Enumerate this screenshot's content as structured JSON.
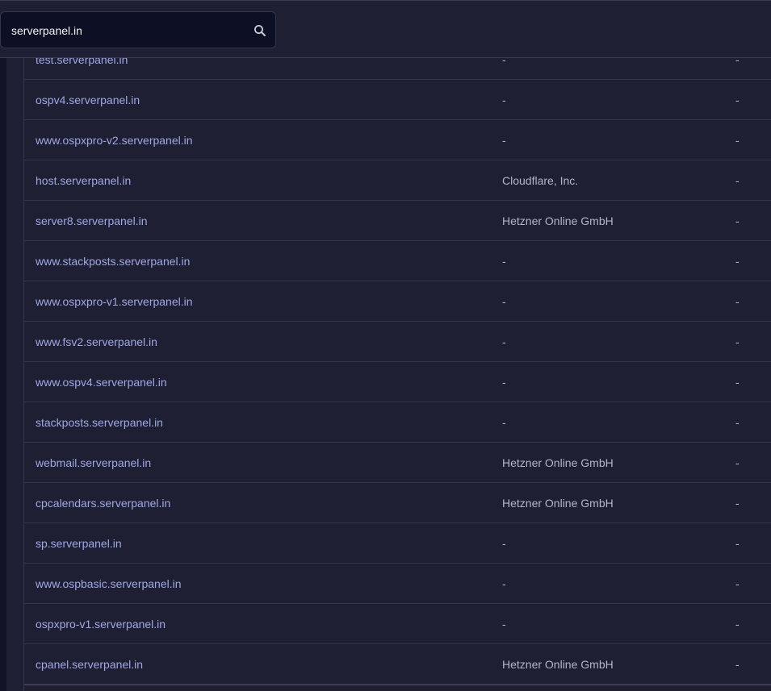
{
  "search": {
    "value": "serverpanel.in",
    "icon": "search-icon"
  },
  "table": {
    "rows": [
      {
        "host": "test.serverpanel.in",
        "org": "-",
        "extra": "-"
      },
      {
        "host": "ospv4.serverpanel.in",
        "org": "-",
        "extra": "-"
      },
      {
        "host": "www.ospxpro-v2.serverpanel.in",
        "org": "-",
        "extra": "-"
      },
      {
        "host": "host.serverpanel.in",
        "org": "Cloudflare, Inc.",
        "extra": "-"
      },
      {
        "host": "server8.serverpanel.in",
        "org": "Hetzner Online GmbH",
        "extra": "-"
      },
      {
        "host": "www.stackposts.serverpanel.in",
        "org": "-",
        "extra": "-"
      },
      {
        "host": "www.ospxpro-v1.serverpanel.in",
        "org": "-",
        "extra": "-"
      },
      {
        "host": "www.fsv2.serverpanel.in",
        "org": "-",
        "extra": "-"
      },
      {
        "host": "www.ospv4.serverpanel.in",
        "org": "-",
        "extra": "-"
      },
      {
        "host": "stackposts.serverpanel.in",
        "org": "-",
        "extra": "-"
      },
      {
        "host": "webmail.serverpanel.in",
        "org": "Hetzner Online GmbH",
        "extra": "-"
      },
      {
        "host": "cpcalendars.serverpanel.in",
        "org": "Hetzner Online GmbH",
        "extra": "-"
      },
      {
        "host": "sp.serverpanel.in",
        "org": "-",
        "extra": "-"
      },
      {
        "host": "www.ospbasic.serverpanel.in",
        "org": "-",
        "extra": "-"
      },
      {
        "host": "ospxpro-v1.serverpanel.in",
        "org": "-",
        "extra": "-"
      },
      {
        "host": "cpanel.serverpanel.in",
        "org": "Hetzner Online GmbH",
        "extra": "-"
      }
    ]
  },
  "colors": {
    "background": "#1e1f33",
    "link": "#a0a8e4",
    "text": "#b4b5c7",
    "search_bg": "#0d0f24"
  }
}
